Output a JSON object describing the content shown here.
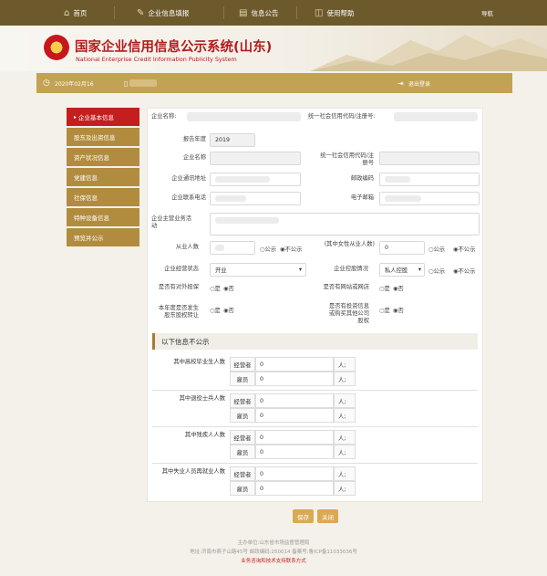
{
  "nav": {
    "items": [
      {
        "label": "首页",
        "icon": "home-icon"
      },
      {
        "label": "企业信息填报",
        "icon": "edit-icon"
      },
      {
        "label": "信息公告",
        "icon": "notice-icon"
      },
      {
        "label": "使用帮助",
        "icon": "help-icon"
      }
    ],
    "right_link": "导航"
  },
  "header": {
    "title_cn": "国家企业信用信息公示系统(山东)",
    "title_en": "National Enterprise Credit Information Publicity System"
  },
  "userbar": {
    "date": "2020年02月16",
    "logout": "退出登录"
  },
  "sidebar": {
    "items": [
      "企业基本信息",
      "股东及出资信息",
      "资产状况信息",
      "党建信息",
      "社保信息",
      "特种设备信息",
      "预览并公示"
    ],
    "active_marker": "▸"
  },
  "form": {
    "company_name_label": "企业名称:",
    "credit_code_label": "统一社会信用代码/注册号:",
    "report_year_label": "报告年度",
    "report_year_value": "2019",
    "name_label": "企业名称",
    "code_label": "统一社会信用代码/注册号",
    "address_label": "企业通讯地址",
    "postcode_label": "邮政编码",
    "phone_label": "企业联系电话",
    "email_label": "电子邮箱",
    "business_label": "企业主营业务活动",
    "employees_label": "从业人数",
    "female_label": "(其中女性从业人数)",
    "female_value": "0",
    "public_label": "公示",
    "not_public_label": "不公示",
    "status_label": "企业经营状态",
    "status_value": "开业",
    "holding_label": "企业控股情况",
    "holding_value": "私人控股",
    "guarantee_label": "是否有对外担保",
    "website_label": "是否有网站或网店",
    "equity_label": "本年度是否发生股东股权转让",
    "invest_label": "是否有投资信息或购买其他公司股权",
    "yes_label": "是",
    "no_label": "否"
  },
  "section": {
    "title": "以下信息不公示",
    "groups": [
      {
        "label": "其中高校毕业生人数",
        "operator_value": "0",
        "employee_value": "0"
      },
      {
        "label": "其中退役士兵人数",
        "operator_value": "0",
        "employee_value": "0"
      },
      {
        "label": "其中残疾人人数",
        "operator_value": "0",
        "employee_value": "0"
      },
      {
        "label": "其中失业人员再就业人数",
        "operator_value": "0",
        "employee_value": "0"
      }
    ],
    "operator_label": "经营者",
    "employee_label": "雇员",
    "unit_label": "人;"
  },
  "buttons": {
    "save": "保存",
    "close": "关闭"
  },
  "footer": {
    "line1": "主办单位:山东省市场监督管理局",
    "line2": "地址:济南市燕子山路45号    邮政编码:250014    备案号:鲁ICP备11033036号",
    "line3": "业务咨询和技术支持联系方式"
  },
  "colors": {
    "nav": "#6d5a2c",
    "accent": "#c2a253",
    "active": "#c41e1e",
    "title": "#b21d1d"
  }
}
